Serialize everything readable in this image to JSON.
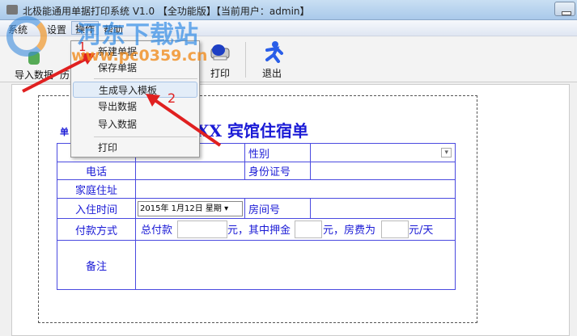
{
  "window": {
    "title": "北极能通用单据打印系统 V1.0 【全功能版】【当前用户：admin】"
  },
  "menubar": [
    "系统",
    "设置",
    "操作",
    "帮助"
  ],
  "toolbar": {
    "import": "导入数据",
    "history": "历",
    "print": "打印",
    "exit": "退出"
  },
  "dropdown": {
    "items": [
      "新建单据",
      "保存单据",
      "生成导入模板",
      "导出数据",
      "导入数据",
      "打印"
    ],
    "highlighted": "生成导入模板"
  },
  "form": {
    "title": "XX 宾馆住宿单",
    "serial_label": "单",
    "labels": {
      "gender": "性别",
      "phone": "电话",
      "id": "身份证号",
      "address": "家庭住址",
      "checkin": "入住时间",
      "room": "房间号",
      "payment": "付款方式",
      "remarks": "备注"
    },
    "checkin_value": "2015年 1月12日 星期",
    "payment": {
      "total": "总付款",
      "yuan1": "元，其中押金",
      "yuan2": "元，房费为",
      "per_day": "元/天"
    }
  },
  "annotations": {
    "step1": "1",
    "step2": "2",
    "arrow_color": "#e02020"
  },
  "watermark": {
    "site": "河东下载站",
    "url": "www.pc0359.cn"
  }
}
